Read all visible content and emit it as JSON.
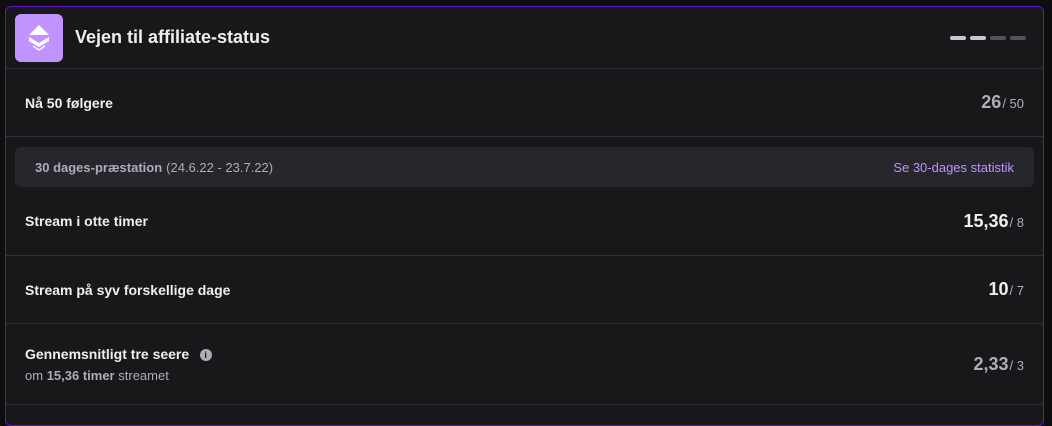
{
  "header": {
    "title": "Vejen til affiliate-status",
    "logo_icon": "affiliate-badge-icon",
    "pager_count": 4,
    "pager_active": 2
  },
  "followers": {
    "label": "Nå 50 følgere",
    "current": "26",
    "goal": "/ 50"
  },
  "performance": {
    "label": "30 dages-præstation",
    "date_range": "(24.6.22 - 23.7.22)",
    "link": "Se 30-dages statistik"
  },
  "rows": [
    {
      "label": "Stream i otte timer",
      "current": "15,36",
      "goal": "/ 8"
    },
    {
      "label": "Stream på syv forskellige dage",
      "current": "10",
      "goal": "/ 7"
    },
    {
      "label": "Gennemsnitligt tre seere",
      "current": "2,33",
      "goal": "/ 3",
      "sub_prefix": "om",
      "sub_bold": "15,36 timer",
      "sub_suffix": "streamet"
    }
  ],
  "colors": {
    "accent": "#bf94ff",
    "border": "#5c16c5",
    "card": "#18181b"
  }
}
